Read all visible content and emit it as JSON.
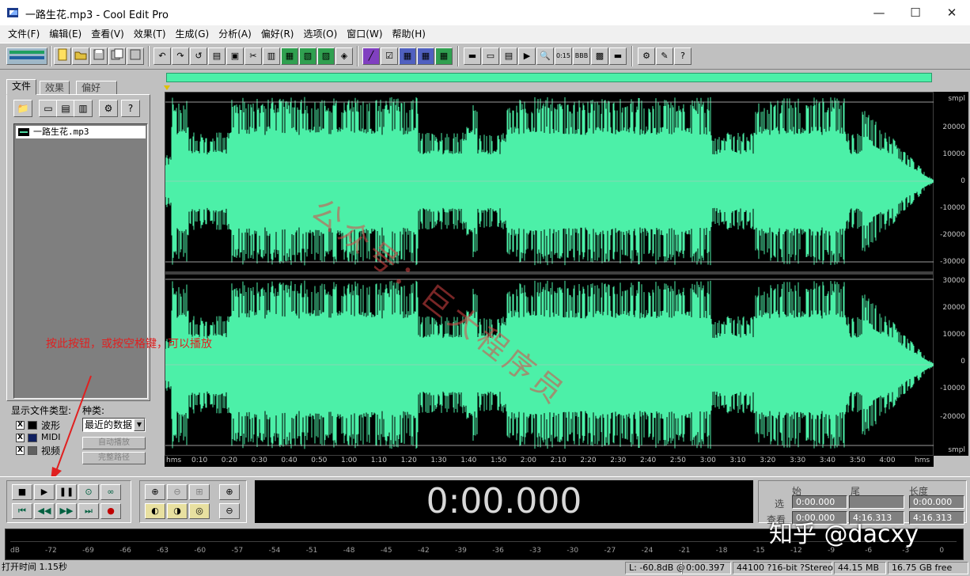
{
  "window": {
    "title": "一路生花.mp3 - Cool Edit Pro",
    "minimize_icon": "—",
    "maximize_icon": "☐",
    "close_icon": "✕"
  },
  "menubar": [
    "文件(F)",
    "编辑(E)",
    "查看(V)",
    "效果(T)",
    "生成(G)",
    "分析(A)",
    "偏好(R)",
    "选项(O)",
    "窗口(W)",
    "帮助(H)"
  ],
  "left_panel": {
    "tabs": [
      "文件",
      "效果",
      "偏好"
    ],
    "active_tab": "文件",
    "file_item": "一路生花.mp3",
    "show_types_label": "显示文件类型:",
    "types": [
      {
        "label": "波形",
        "checked": "X"
      },
      {
        "label": "MIDI",
        "checked": "X"
      },
      {
        "label": "视频",
        "checked": "X"
      }
    ],
    "category_label": "种类:",
    "category_value": "最近的数据",
    "autoplay_button": "自动播放",
    "fullpath_button": "完整路径"
  },
  "scale": {
    "top": [
      "smpl",
      "20000",
      "10000",
      "0",
      "-10000",
      "-20000",
      "-30000"
    ],
    "bottom": [
      "30000",
      "20000",
      "10000",
      "0",
      "-10000",
      "-20000",
      "smpl"
    ]
  },
  "timeline": [
    "hms",
    "0:10",
    "0:20",
    "0:30",
    "0:40",
    "0:50",
    "1:00",
    "1:10",
    "1:20",
    "1:30",
    "1:40",
    "1:50",
    "2:00",
    "2:10",
    "2:20",
    "2:30",
    "2:40",
    "2:50",
    "3:00",
    "3:10",
    "3:20",
    "3:30",
    "3:40",
    "3:50",
    "4:00",
    "hms"
  ],
  "transport": {
    "time": "0:00.000",
    "headers": {
      "start": "始",
      "end": "尾",
      "length": "长度"
    },
    "rows": [
      {
        "label": "选",
        "start": "0:00.000",
        "end": "",
        "length": "0:00.000"
      },
      {
        "label": "查看",
        "start": "0:00.000",
        "end": "4:16.313",
        "length": "4:16.313"
      }
    ]
  },
  "meter_scale": [
    "dB",
    "-72",
    "-69",
    "-66",
    "-63",
    "-60",
    "-57",
    "-54",
    "-51",
    "-48",
    "-45",
    "-42",
    "-39",
    "-36",
    "-33",
    "-30",
    "-27",
    "-24",
    "-21",
    "-18",
    "-15",
    "-12",
    "-9",
    "-6",
    "-3",
    "0"
  ],
  "status": {
    "open_time": "打开时间  1.15秒",
    "level": "L: -60.8dB @",
    "position": "0:00.397",
    "format": "44100 ?16-bit ?Stereo",
    "size": "44.15 MB",
    "free": "16.75 GB free"
  },
  "annotation": {
    "text": "按此按钮，或按空格键，可以播放"
  },
  "watermarks": {
    "red": "公众号：巨大程序员",
    "zhihu": "知乎 @dacxy"
  },
  "colors": {
    "waveform": "#4cf0a8",
    "wave_bg": "#000000",
    "annotation": "#e02020",
    "panel": "#c0c0c0"
  }
}
